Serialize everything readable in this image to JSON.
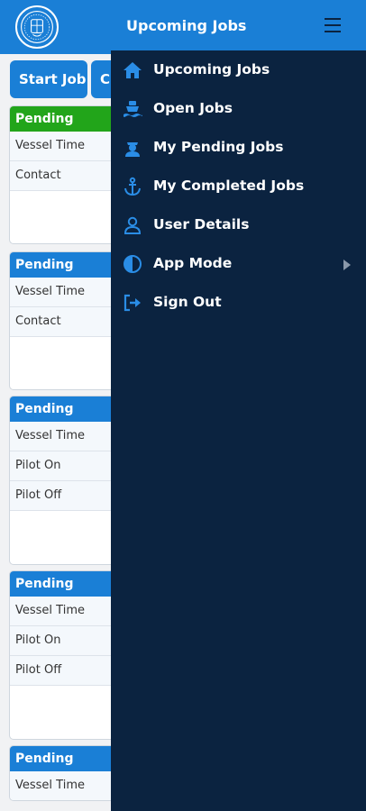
{
  "header": {
    "title": "Upcoming Jobs"
  },
  "actions": {
    "start_job": "Start Job",
    "second_button": "C"
  },
  "jobs": [
    {
      "status": "Pending",
      "status_color": "#22a51a",
      "rows": [
        "Vessel Time",
        "Contact"
      ]
    },
    {
      "status": "Pending",
      "status_color": "#1a7fd6",
      "rows": [
        "Vessel Time",
        "Contact"
      ]
    },
    {
      "status": "Pending",
      "status_color": "#1a7fd6",
      "rows": [
        "Vessel Time",
        "Pilot On",
        "Pilot Off"
      ]
    },
    {
      "status": "Pending",
      "status_color": "#1a7fd6",
      "rows": [
        "Vessel Time",
        "Pilot On",
        "Pilot Off"
      ]
    },
    {
      "status": "Pending",
      "status_color": "#1a7fd6",
      "rows": [
        "Vessel Time"
      ]
    }
  ],
  "menu": {
    "items": [
      {
        "label": "Upcoming Jobs",
        "icon": "home-icon"
      },
      {
        "label": "Open Jobs",
        "icon": "ship-icon"
      },
      {
        "label": "My Pending Jobs",
        "icon": "captain-icon"
      },
      {
        "label": "My Completed Jobs",
        "icon": "anchor-icon"
      },
      {
        "label": "User Details",
        "icon": "user-icon"
      },
      {
        "label": "App Mode",
        "icon": "contrast-icon"
      },
      {
        "label": "Sign Out",
        "icon": "sign-out-icon"
      }
    ]
  },
  "colors": {
    "primary": "#1a7fd6",
    "drawer": "#0b2340",
    "pending_green": "#22a51a",
    "icon_blue": "#2a8de6"
  }
}
